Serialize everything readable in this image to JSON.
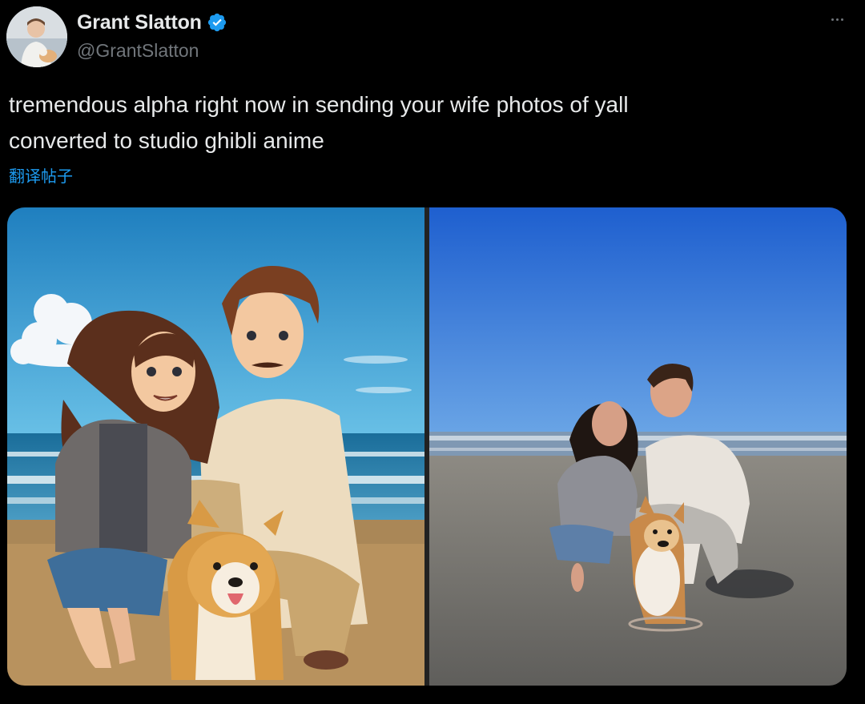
{
  "author": {
    "display_name": "Grant Slatton",
    "handle": "@GrantSlatton",
    "verified": true,
    "avatar_icon": "profile-avatar"
  },
  "tweet": {
    "text": "tremendous alpha right now in sending your wife photos of yall\nconverted to studio ghibli anime",
    "translate_label": "翻译帖子"
  },
  "actions": {
    "more_icon": "more-dots-icon"
  },
  "media": {
    "left_photo": "anime-style-couple-with-corgi",
    "right_photo": "real-photo-couple-with-corgi-on-beach"
  },
  "colors": {
    "background": "#000000",
    "text_primary": "#e7e9ea",
    "text_secondary": "#71767b",
    "accent": "#1d9bf0"
  }
}
